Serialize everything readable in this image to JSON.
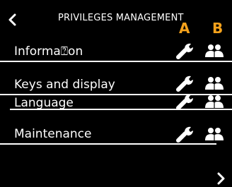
{
  "header": {
    "title": "PRIVILEGES MANAGEMENT",
    "back_icon": "chevron-left-icon"
  },
  "columns": {
    "a_label": "A",
    "b_label": "B",
    "label_color": "#f5a21c"
  },
  "rows": [
    {
      "label": "Informa⍰on",
      "icon_a": "wrench-icon",
      "icon_b": "people-icon"
    },
    {
      "label": "Keys and display",
      "icon_a": "wrench-icon",
      "icon_b": "people-icon"
    },
    {
      "label": "Language",
      "icon_a": "wrench-icon",
      "icon_b": "people-icon"
    },
    {
      "label": "Maintenance",
      "icon_a": "wrench-icon",
      "icon_b": "people-icon"
    }
  ],
  "footer": {
    "next_icon": "chevron-right-icon"
  }
}
